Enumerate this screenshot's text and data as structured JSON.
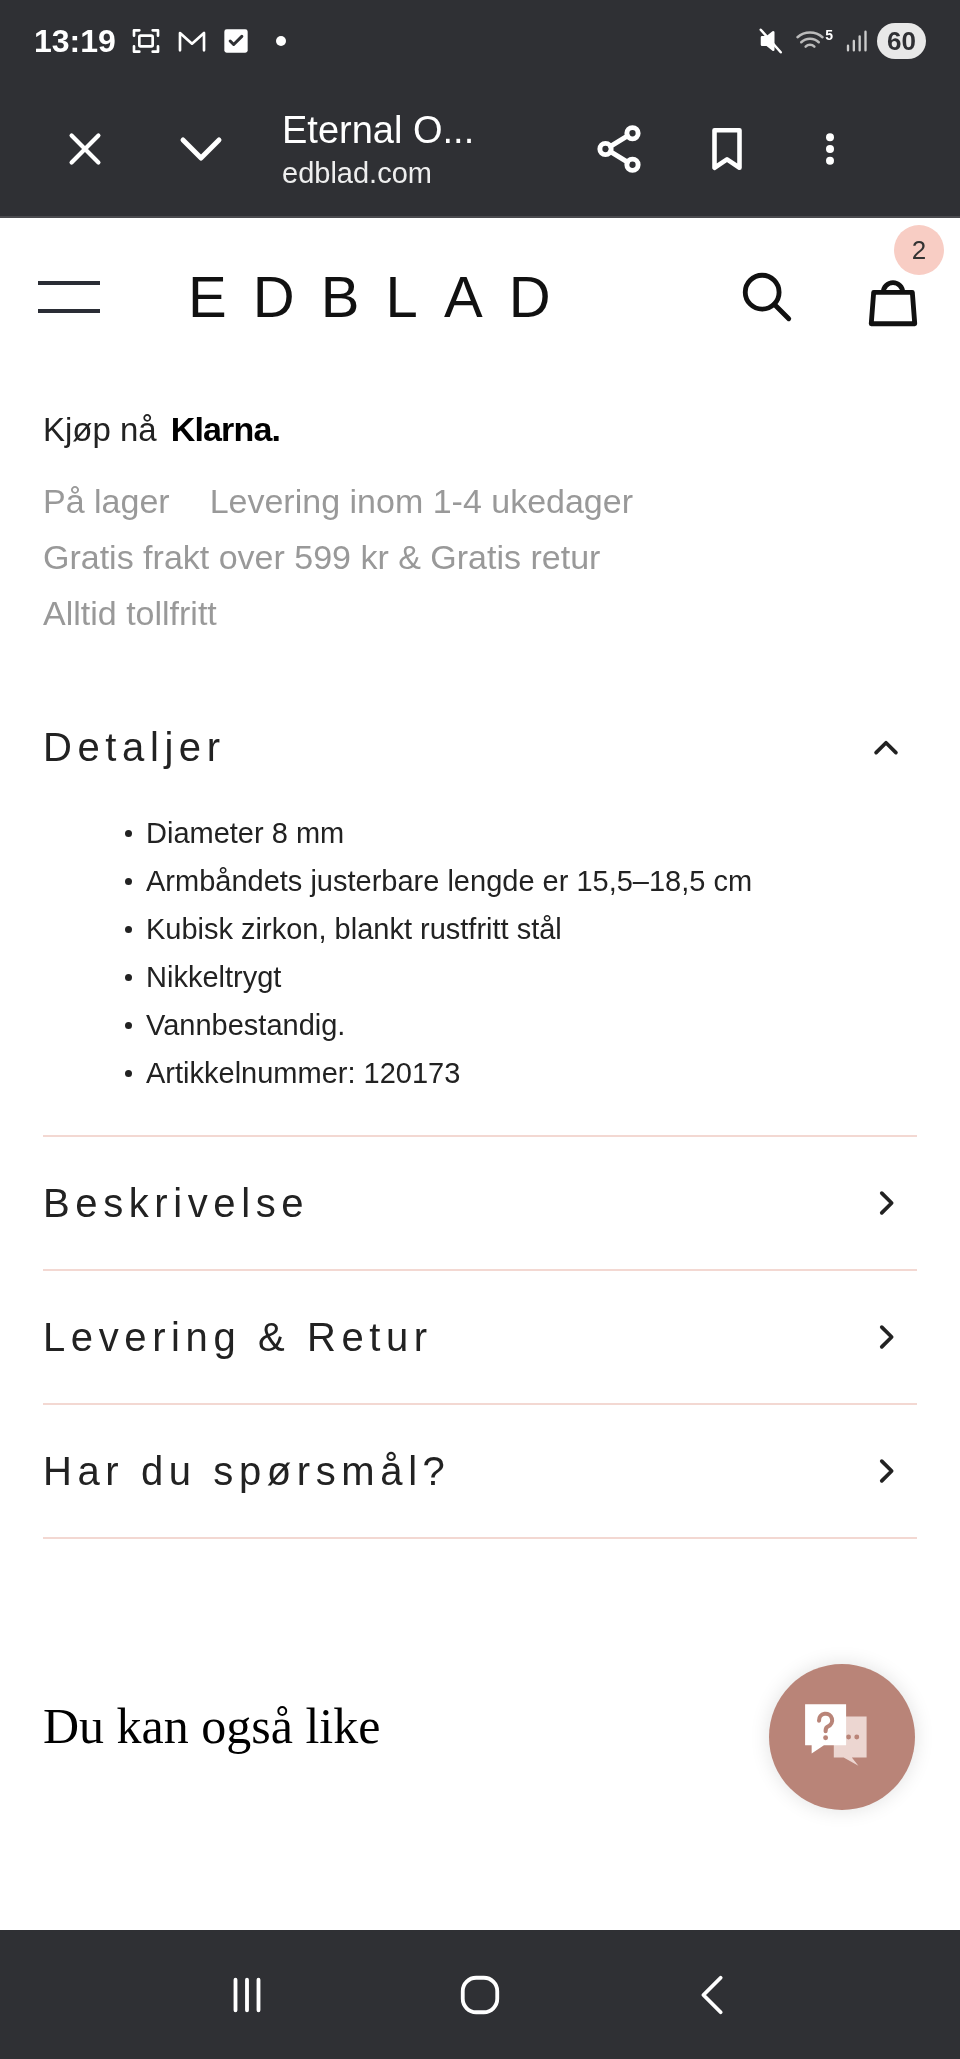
{
  "status_bar": {
    "time": "13:19",
    "network_badge": "5",
    "battery": "60"
  },
  "browser_bar": {
    "title": "Eternal O...",
    "url": "edblad.com"
  },
  "header": {
    "logo": "EDBLAD",
    "cart_count": "2"
  },
  "purchase": {
    "prefix": "Kjøp nå",
    "klarna": "Klarna."
  },
  "info": {
    "stock": "På lager",
    "delivery": "Levering inom 1-4 ukedager",
    "lines": [
      "Gratis frakt over 599 kr & Gratis retur",
      "Alltid tollfritt"
    ]
  },
  "sections": [
    {
      "title": "Detaljer",
      "expanded": true,
      "items": [
        "Diameter 8 mm",
        "Armbåndets justerbare lengde er 15,5–18,5 cm",
        "Kubisk zirkon, blankt rustfritt stål",
        "Nikkeltrygt",
        "Vannbestandig.",
        "Artikkelnummer: 120173"
      ]
    },
    {
      "title": "Beskrivelse",
      "expanded": false
    },
    {
      "title": "Levering & Retur",
      "expanded": false
    },
    {
      "title": "Har du spørsmål?",
      "expanded": false
    }
  ],
  "recommendations": {
    "heading": "Du kan også like"
  }
}
